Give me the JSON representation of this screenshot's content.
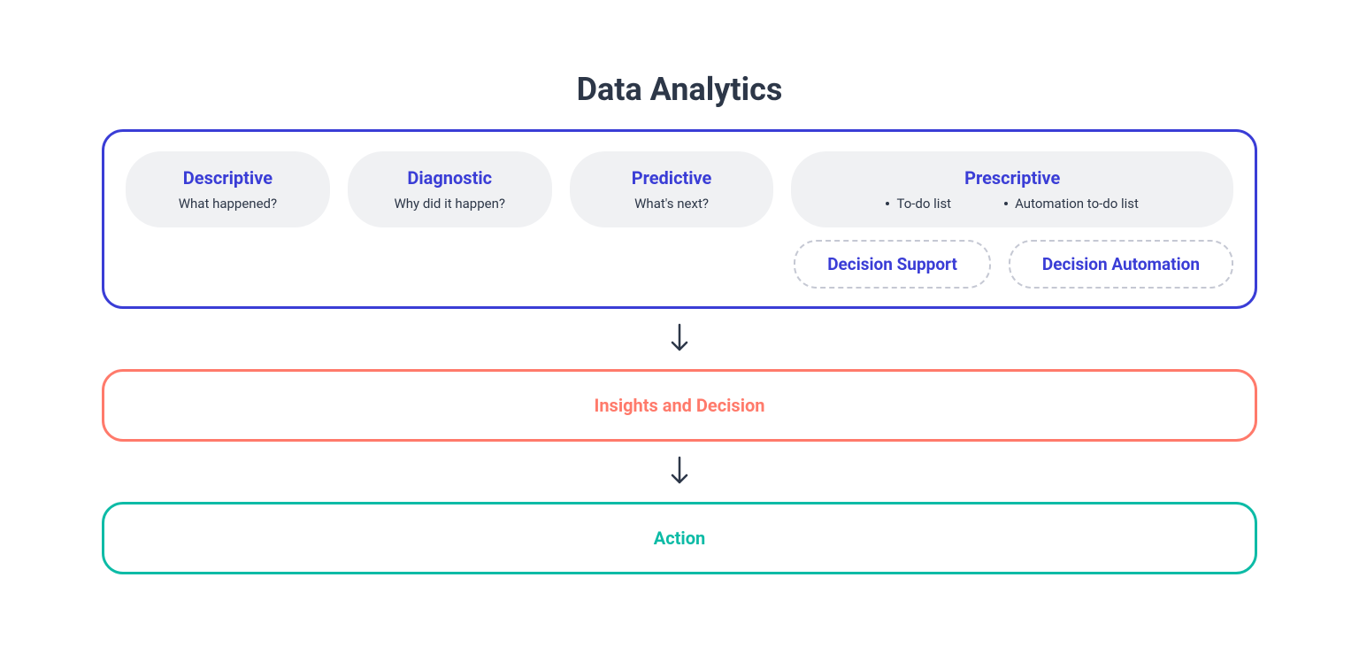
{
  "title": "Data Analytics",
  "analytics": {
    "pills": [
      {
        "title": "Descriptive",
        "subtitle": "What happened?"
      },
      {
        "title": "Diagnostic",
        "subtitle": "Why did it happen?"
      },
      {
        "title": "Predictive",
        "subtitle": "What's next?"
      }
    ],
    "prescriptive": {
      "title": "Prescriptive",
      "bullets": [
        "To-do list",
        "Automation to-do list"
      ]
    },
    "dashed": [
      "Decision Support",
      "Decision Automation"
    ]
  },
  "insights": "Insights and Decision",
  "action": "Action"
}
